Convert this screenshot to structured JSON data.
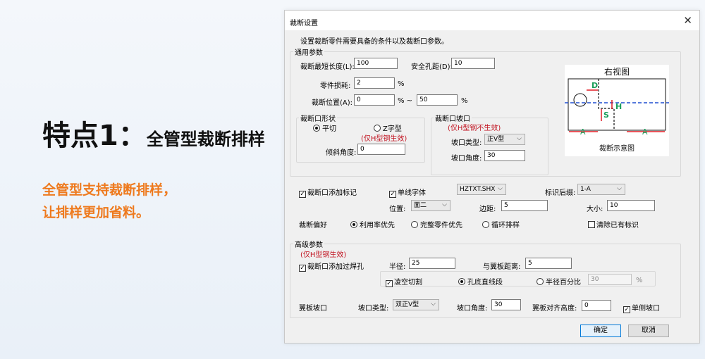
{
  "promo": {
    "title_big": "特点1：",
    "title_small": "全管型裁断排样",
    "desc_line1": "全管型支持裁断排样，",
    "desc_line2": "让排样更加省料。"
  },
  "dialog": {
    "title": "裁断设置",
    "close_glyph": "✕",
    "intro": "设置裁断零件需要具备的条件以及裁断口参数。",
    "general": {
      "legend": "通用参数",
      "min_length_label": "裁断最短长度(L):",
      "min_length_value": "100",
      "hole_dist_label": "安全孔距(D):",
      "hole_dist_value": "10",
      "loss_label": "零件损耗:",
      "loss_value": "2",
      "loss_unit": "%",
      "pos_label": "裁断位置(A):",
      "pos_from": "0",
      "pos_sep": "% ~",
      "pos_to": "50",
      "pos_unit": "%"
    },
    "shape": {
      "legend": "裁断口形状",
      "flat_label": "平切",
      "z_label": "Z字型",
      "h_note": "(仅H型钢生效)",
      "tilt_label": "倾斜角度:",
      "tilt_value": "0"
    },
    "bevel": {
      "legend": "裁断口坡口",
      "note": "(仅H型钢不生效)",
      "type_label": "坡口类型:",
      "type_value": "正V型",
      "angle_label": "坡口角度:",
      "angle_value": "30"
    },
    "diagram": {
      "title": "右视图",
      "caption": "裁断示意图",
      "d_label": "D",
      "s_label": "S",
      "h_label": "H",
      "a_label": "A"
    },
    "marking": {
      "add_mark_label": "裁断口添加标记",
      "single_font_label": "单线字体",
      "font_value": "HZTXT.SHX",
      "suffix_label": "标识后缀:",
      "suffix_value": "1-A",
      "position_label": "位置:",
      "position_value": "面二",
      "margin_label": "边距:",
      "margin_value": "5",
      "size_label": "大小:",
      "size_value": "10"
    },
    "preference": {
      "label": "裁断偏好",
      "opt1": "利用率优先",
      "opt2": "完整零件优先",
      "opt3": "循环排样",
      "clear_label": "清除已有标识"
    },
    "advanced": {
      "legend": "高级参数",
      "note": "(仅H型钢生效)",
      "weld_hole_label": "裁断口添加过焊孔",
      "radius_label": "半径:",
      "radius_value": "25",
      "wing_dist_label": "与翼板距离:",
      "wing_dist_value": "5",
      "cross_cut_label": "凌空切割",
      "straight_label": "孔底直线段",
      "percent_label": "半径百分比",
      "percent_value": "30",
      "percent_unit": "%",
      "wing_bevel_label": "翼板坡口",
      "wing_type_label": "坡口类型:",
      "wing_type_value": "双正V型",
      "wing_angle_label": "坡口角度:",
      "wing_angle_value": "30",
      "align_label": "翼板对齐高度:",
      "align_value": "0",
      "single_side_label": "单侧坡口"
    },
    "ok_label": "确定",
    "cancel_label": "取消",
    "check_glyph": "✓",
    "arrow_glyph": "⌵"
  },
  "colors": {
    "accent_orange": "#ee7a1e",
    "note_red": "#c1121f",
    "diagram_red": "#e01b24",
    "diagram_green": "#1a9e5a",
    "diagram_blue": "#1f4fd1"
  }
}
